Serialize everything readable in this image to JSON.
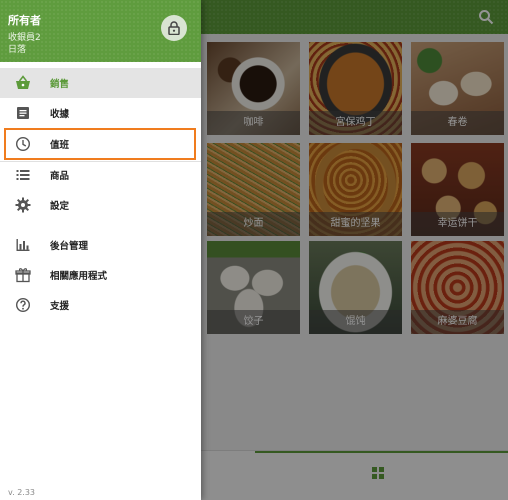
{
  "drawer": {
    "owner": "所有者",
    "cashier": "收銀員2",
    "shift": "日落",
    "version": "v. 2.33",
    "items": [
      {
        "label": "銷售",
        "icon": "basket-icon",
        "active": true
      },
      {
        "label": "收據",
        "icon": "receipt-icon"
      },
      {
        "label": "值班",
        "icon": "clock-icon",
        "highlighted": true
      },
      {
        "label": "商品",
        "icon": "list-icon"
      },
      {
        "label": "設定",
        "icon": "gear-icon"
      },
      {
        "label": "後台管理",
        "icon": "bar-chart-icon"
      },
      {
        "label": "相關應用程式",
        "icon": "apps-icon"
      },
      {
        "label": "支援",
        "icon": "help-icon"
      }
    ]
  },
  "products": [
    {
      "label": "咖啡"
    },
    {
      "label": "宮保鸡丁"
    },
    {
      "label": "春卷"
    },
    {
      "label": "炒面"
    },
    {
      "label": "甜蜜的坚果"
    },
    {
      "label": "幸运饼干"
    },
    {
      "label": "饺子"
    },
    {
      "label": "馄饨"
    },
    {
      "label": "麻婆豆腐"
    }
  ],
  "colors": {
    "accent": "#5c9a3a",
    "highlight": "#f07c1e"
  }
}
